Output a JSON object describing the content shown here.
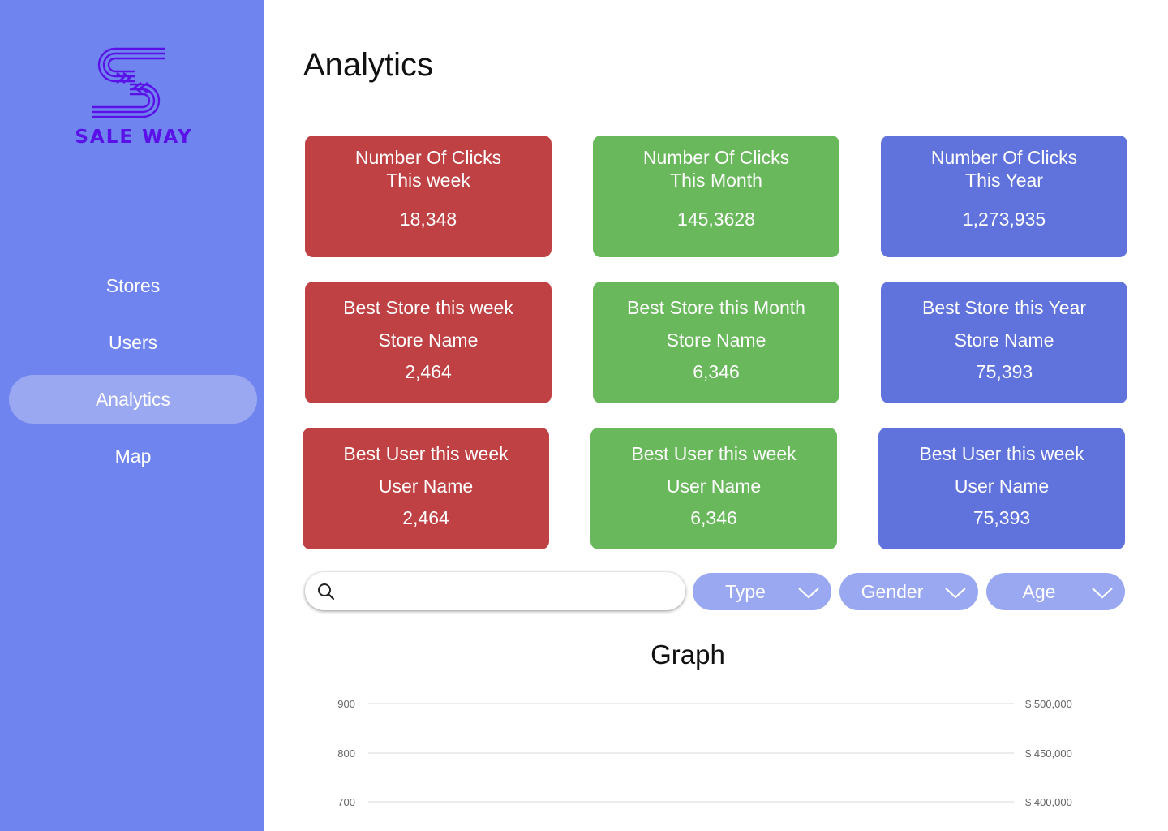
{
  "brand": {
    "name": "SALE WAY",
    "color": "#5a11e8"
  },
  "sidebar": {
    "items": [
      {
        "label": "Stores",
        "active": false
      },
      {
        "label": "Users",
        "active": false
      },
      {
        "label": "Analytics",
        "active": true
      },
      {
        "label": "Map",
        "active": false
      }
    ]
  },
  "page": {
    "title": "Analytics"
  },
  "cards": {
    "clicks_week": {
      "title1": "Number Of Clicks",
      "title2": "This week",
      "value": "18,348"
    },
    "clicks_month": {
      "title1": "Number Of Clicks",
      "title2": "This Month",
      "value": "145,3628"
    },
    "clicks_year": {
      "title1": "Number Of Clicks",
      "title2": "This Year",
      "value": "1,273,935"
    },
    "store_week": {
      "title": "Best Store this week",
      "name": "Store Name",
      "value": "2,464"
    },
    "store_month": {
      "title": "Best Store this Month",
      "name": "Store Name",
      "value": "6,346"
    },
    "store_year": {
      "title": "Best Store this Year",
      "name": "Store Name",
      "value": "75,393"
    },
    "user_1": {
      "title": "Best User this week",
      "name": "User Name",
      "value": "2,464"
    },
    "user_2": {
      "title": "Best User this week",
      "name": "User Name",
      "value": "6,346"
    },
    "user_3": {
      "title": "Best User this week",
      "name": "User Name",
      "value": "75,393"
    }
  },
  "colors": {
    "red": "#c04143",
    "green": "#6ab85c",
    "blue": "#6072dc",
    "sidebar": "#6f84ee",
    "active_pill": "#9aa8f2"
  },
  "filters": {
    "search": {
      "value": "",
      "placeholder": ""
    },
    "type": "Type",
    "gender": "Gender",
    "age": "Age"
  },
  "graph": {
    "title": "Graph"
  },
  "chart_data": {
    "type": "line",
    "title": "Graph",
    "left_ticks": [
      "900",
      "800",
      "700"
    ],
    "right_ticks": [
      "$ 500,000",
      "$ 450,000",
      "$ 400,000"
    ],
    "left_values": [
      900,
      800,
      700
    ],
    "right_values": [
      500000,
      450000,
      400000
    ],
    "series": [],
    "grid": true
  }
}
